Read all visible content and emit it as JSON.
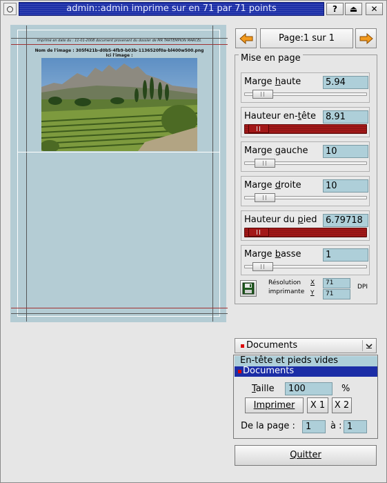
{
  "titlebar": {
    "title": "admin::admin imprime sur  en 71 par 71 points",
    "help_label": "?",
    "shade_label": "⏏",
    "close_label": "✕"
  },
  "preview": {
    "header_text": "imprimé en date du : 11-01-2008 document provenant du dossier de MR TARTEMPION MARCEL",
    "image_name_line": "Nom de l'image : 305f421b-d0b5-4fb9-b03b-1136520f0a-bl400w500.png",
    "image_caption": "Ici l'image :"
  },
  "nav": {
    "prev_icon": "arrow-left-icon",
    "next_icon": "arrow-right-icon",
    "page_label": "Page:1 sur 1"
  },
  "mise_en_page": {
    "legend": "Mise en page",
    "params": [
      {
        "label_pre": "Marge ",
        "label_u": "h",
        "label_post": "aute",
        "value": "5.94",
        "level": 0.08,
        "error": false
      },
      {
        "label_pre": "Hauteur en-",
        "label_u": "t",
        "label_post": "ête",
        "value": "8.91",
        "level": 0.04,
        "error": true
      },
      {
        "label_pre": "Marge ",
        "label_u": "g",
        "label_post": "auche",
        "value": "10",
        "level": 0.1,
        "error": false
      },
      {
        "label_pre": "Marge ",
        "label_u": "d",
        "label_post": "roite",
        "value": "10",
        "level": 0.1,
        "error": false
      },
      {
        "label_pre": "Hauteur du ",
        "label_u": "p",
        "label_post": "ied",
        "value": "6.79718",
        "level": 0.04,
        "error": true
      },
      {
        "label_pre": "Marge ",
        "label_u": "b",
        "label_post": "asse",
        "value": "1",
        "level": 0.08,
        "error": false
      }
    ],
    "resolution_label_1": "Résolution",
    "resolution_label_2": "imprimante",
    "x_label": "X",
    "y_label": "Y",
    "x_value": "71",
    "y_value": "71",
    "dpi_label": "DPI"
  },
  "documents": {
    "combo_value": "Documents",
    "list_items": [
      "En-tête et pieds vides",
      "Documents"
    ],
    "taille_label": "Taille",
    "taille_value": "100",
    "percent_label": "%",
    "print_button": "Imprimer",
    "x1_button": "X 1",
    "x2_button": "X 2",
    "from_page_label": "De la page :",
    "from_page_value": "1",
    "to_label": "à :",
    "to_page_value": "1"
  },
  "quit_button": "Quitter",
  "colors": {
    "titlebar": "#1c2fa8",
    "error_slider": "#a31818",
    "field_bg": "#aecfd9",
    "preview_bg": "#b4ccd4",
    "selection": "#1b2da6"
  }
}
